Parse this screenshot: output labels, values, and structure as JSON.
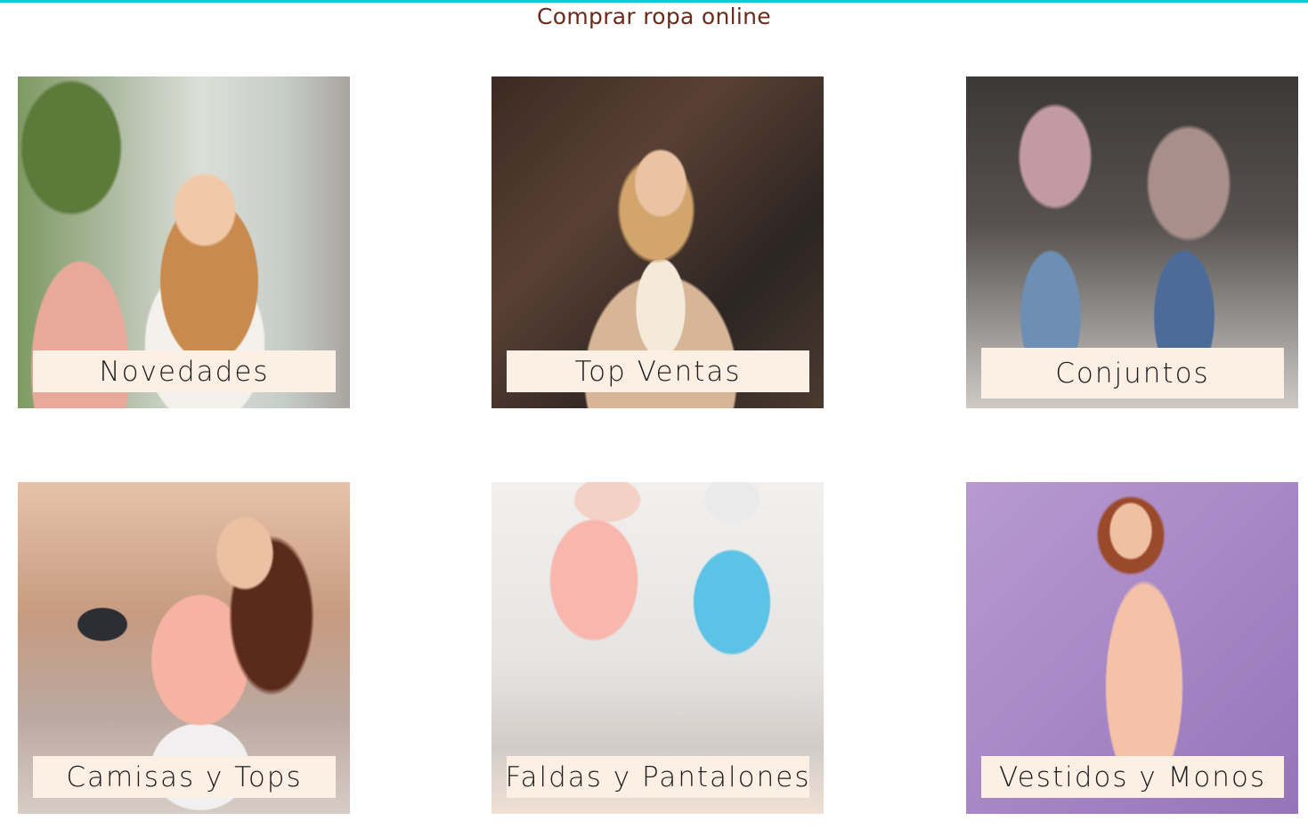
{
  "page": {
    "title": "Comprar ropa online",
    "accent_color": "#18c3de",
    "title_color": "#6b2a1a",
    "caption_background": "#fcefe4"
  },
  "categories": [
    {
      "label": "Novedades",
      "image": "woman-pink-coat-street-photo"
    },
    {
      "label": "Top Ventas",
      "image": "woman-beige-trench-coat-photo"
    },
    {
      "label": "Conjuntos",
      "image": "runway-models-jeans-photo"
    },
    {
      "label": "Camisas y Tops",
      "image": "woman-pink-shirt-street-photo"
    },
    {
      "label": "Faldas y Pantalones",
      "image": "tulle-skirts-pink-blue-photo"
    },
    {
      "label": "Vestidos y Monos",
      "image": "woman-floral-dress-lilac-photo"
    }
  ]
}
